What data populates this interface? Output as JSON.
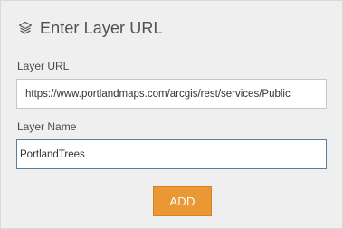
{
  "dialog": {
    "title": "Enter Layer URL",
    "icon": "layers-icon"
  },
  "fields": {
    "url": {
      "label": "Layer URL",
      "value": "https://www.portlandmaps.com/arcgis/rest/services/Public"
    },
    "name": {
      "label": "Layer Name",
      "value": "PortlandTrees"
    }
  },
  "actions": {
    "add_label": "ADD"
  },
  "colors": {
    "panel_background": "#efefef",
    "accent_button": "#ea9734",
    "focused_border": "#5a7da8"
  }
}
